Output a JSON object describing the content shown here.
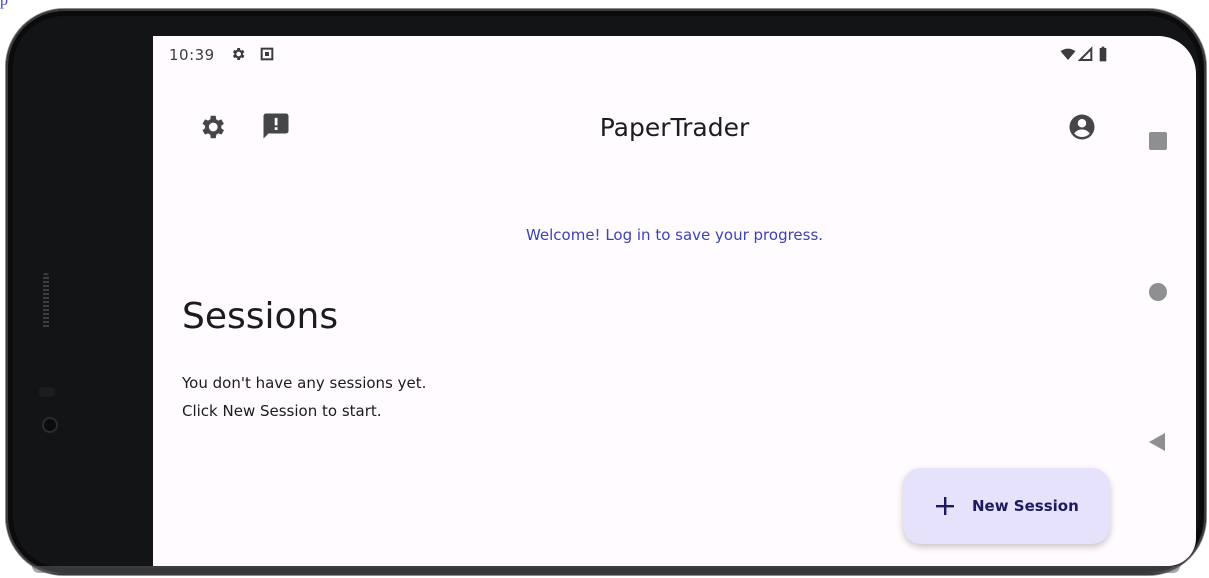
{
  "top_link": "p",
  "status_bar": {
    "time": "10:39",
    "icons": [
      "settings-gear-icon",
      "notification-square-icon"
    ],
    "right_icons": [
      "wifi-icon",
      "cell-signal-icon",
      "battery-icon"
    ]
  },
  "app_bar": {
    "title": "PaperTrader",
    "left_icons": [
      "settings-icon",
      "feedback-icon"
    ],
    "right_icon": "account-circle-icon"
  },
  "welcome_message": "Welcome! Log in to save your progress.",
  "sessions": {
    "title": "Sessions",
    "empty_line_1": "You don't have any sessions yet.",
    "empty_line_2": "Click New Session to start."
  },
  "fab": {
    "icon": "plus-icon",
    "label": "New Session"
  },
  "nav_bar": [
    "recents-square-icon",
    "home-circle-icon",
    "back-triangle-icon"
  ],
  "colors": {
    "screen_bg": "#fffbfe",
    "accent_link": "#3a43b8",
    "fab_bg": "#e6e2fb",
    "fab_text": "#1d1a5e",
    "text_primary": "#1c1b1f"
  }
}
